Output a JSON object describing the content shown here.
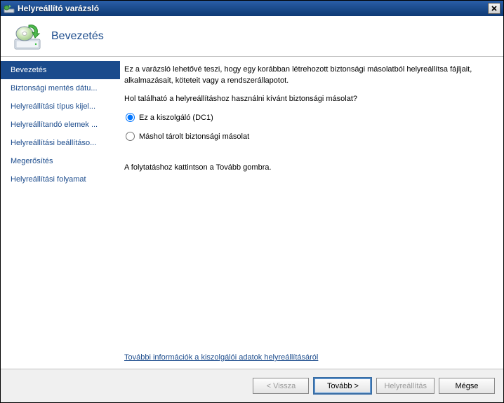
{
  "window": {
    "title": "Helyreállító varázsló"
  },
  "header": {
    "title": "Bevezetés"
  },
  "sidebar": {
    "steps": [
      {
        "label": "Bevezetés",
        "active": true
      },
      {
        "label": "Biztonsági mentés dátu..."
      },
      {
        "label": "Helyreállítási típus kijel..."
      },
      {
        "label": "Helyreállítandó elemek ..."
      },
      {
        "label": "Helyreállítási beállításo..."
      },
      {
        "label": "Megerősítés"
      },
      {
        "label": "Helyreállítási folyamat"
      }
    ]
  },
  "content": {
    "intro": "Ez a varázsló lehetővé teszi, hogy egy korábban létrehozott biztonsági másolatból helyreállítsa fájljait, alkalmazásait, köteteit vagy a rendszerállapotot.",
    "question": "Hol található a helyreállításhoz használni kívánt biztonsági másolat?",
    "radio1": "Ez a kiszolgáló (DC1)",
    "radio2": "Máshol tárolt biztonsági másolat",
    "continue": "A folytatáshoz kattintson a Tovább gombra.",
    "link": "További információk a kiszolgálói adatok helyreállításáról"
  },
  "footer": {
    "back": "< Vissza",
    "next": "Tovább >",
    "recover": "Helyreállítás",
    "cancel": "Mégse"
  }
}
